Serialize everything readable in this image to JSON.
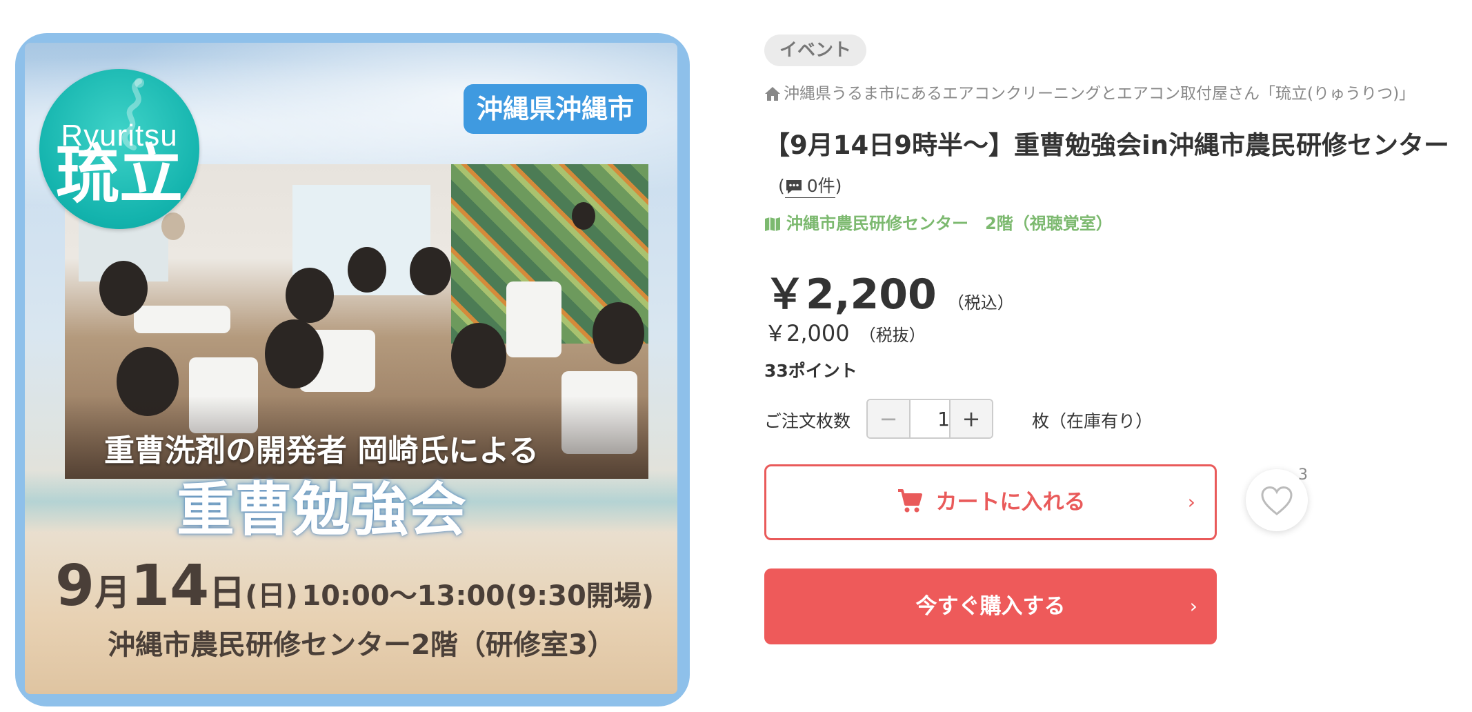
{
  "poster": {
    "logo_en": "Ryuritsu",
    "logo_jp": "琉立",
    "city_badge": "沖縄県沖縄市",
    "subtitle": "重曹洗剤の開発者 岡崎氏による",
    "title": "重曹勉強会",
    "date_month": "9",
    "date_month_unit": "月",
    "date_day": "14",
    "date_day_unit": "日",
    "date_weekday": "(日)",
    "date_time": "10:00〜13:00(9:30開場)",
    "venue": "沖縄市農民研修センター2階（研修室3）"
  },
  "product": {
    "category": "イベント",
    "shop_name": "沖縄県うるま市にあるエアコンクリーニングとエアコン取付屋さん「琉立(りゅうりつ)」",
    "title": "【9月14日9時半〜】重曹勉強会in沖縄市農民研修センター",
    "review_open": "(",
    "review_count": "0件",
    "review_close": ")",
    "venue": "沖縄市農民研修センター　2階（視聴覚室）",
    "price_incl": "￥2,200",
    "price_incl_label": "（税込）",
    "price_excl": "￥2,000",
    "price_excl_label": "（税抜）",
    "points": "33ポイント"
  },
  "order": {
    "qty_label": "ご注文枚数",
    "minus": "−",
    "qty_value": "1",
    "plus": "+",
    "stock_text": "枚（在庫有り）"
  },
  "actions": {
    "cart_label": "カートに入れる",
    "buy_label": "今すぐ購入する",
    "chevron": "›",
    "favorite_count": "3"
  },
  "icons": {
    "home": "home-icon",
    "comment": "comment-icon",
    "map": "map-icon",
    "cart": "cart-icon",
    "heart": "heart-icon"
  },
  "colors": {
    "accent_red": "#ee5a5a",
    "venue_green": "#7cb96f",
    "badge_blue": "#3f9ae0",
    "logo_teal": "#13b3ad",
    "frame_blue": "#8ec0ea"
  }
}
